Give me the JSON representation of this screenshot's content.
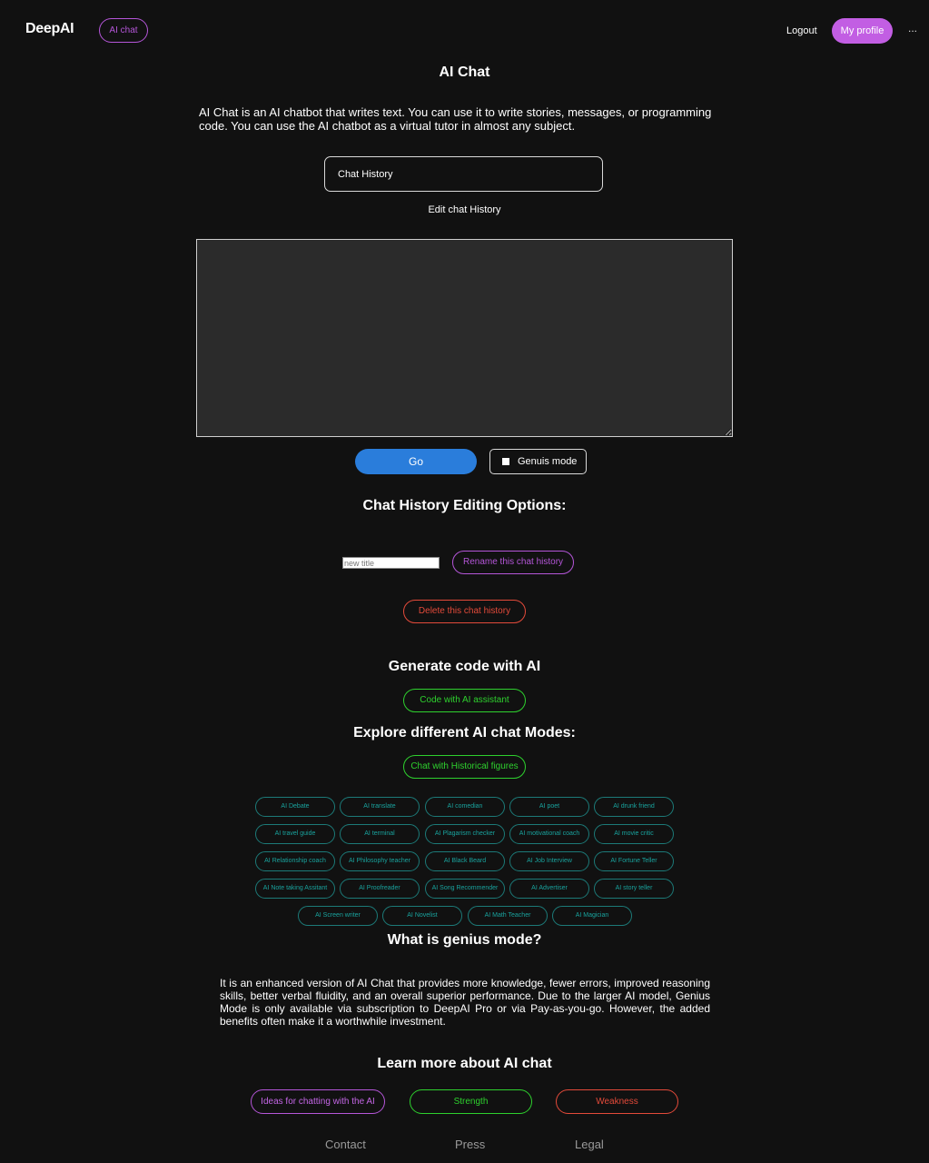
{
  "header": {
    "logo": "DeepAI",
    "nav_pill": "AI chat",
    "logout": "Logout",
    "profile": "My profile",
    "more": "..."
  },
  "main": {
    "title": "AI Chat",
    "intro": "AI Chat is an AI chatbot that writes text. You can use it to write stories, messages, or programming code. You can use the AI chatbot as a virtual tutor in almost any subject.",
    "history_select_value": "Chat History",
    "edit_history": "Edit chat History",
    "chat_input_value": "",
    "go_label": "Go",
    "genius_label": "Genuis mode"
  },
  "editing": {
    "heading": "Chat History Editing Options:",
    "new_title_placeholder": "new title",
    "rename_label": "Rename this chat history",
    "delete_label": "Delete this chat history"
  },
  "code": {
    "heading": "Generate code with AI",
    "button": "Code with AI assistant"
  },
  "modes": {
    "heading": "Explore different AI chat Modes:",
    "historical": "Chat with Historical figures",
    "items": [
      "AI Debate",
      "AI translate",
      "AI comedian",
      "AI poet",
      "AI drunk friend",
      "AI travel guide",
      "AI terminal",
      "AI Plagarism checker",
      "AI motivational coach",
      "AI movie critic",
      "AI Relationship coach",
      "AI Philosophy teacher",
      "AI Black Beard",
      "AI Job Interview",
      "AI Fortune Teller",
      "AI Note taking Assitant",
      "AI Proofreader",
      "AI Song Recommender",
      "AI Advertiser",
      "AI story teller",
      "AI Screen writer",
      "AI Novelist",
      "AI Math Teacher",
      "AI Magician"
    ]
  },
  "genius": {
    "heading": "What is genius mode?",
    "description": "It is an enhanced version of AI Chat that provides more knowledge, fewer errors, improved reasoning skills, better verbal fluidity, and an overall superior performance. Due to the larger AI model, Genius Mode is only available via subscription to DeepAI Pro or via Pay-as-you-go. However, the added benefits often make it a worthwhile investment."
  },
  "learn": {
    "heading": "Learn more about AI chat",
    "ideas": "Ideas for chatting with the AI",
    "strength": "Strength",
    "weakness": "Weakness"
  },
  "footer": {
    "contact": "Contact",
    "press": "Press",
    "legal": "Legal"
  },
  "colors": {
    "background": "#111111",
    "purple": "#b556d9",
    "profile_bg": "#c25ee3",
    "blue": "#2a7ddb",
    "green": "#2ed12e",
    "red": "#e34a3a",
    "teal": "#19a39e"
  }
}
